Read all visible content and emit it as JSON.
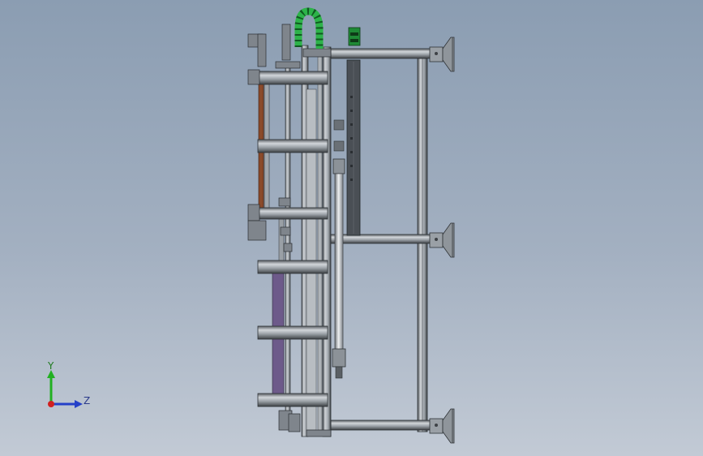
{
  "viewport": {
    "background_top": "#8b9db2",
    "background_bottom": "#c2cad5"
  },
  "model": {
    "frame_color": "#7f858c",
    "frame_dark": "#3e4246",
    "frame_light": "#c9ced3",
    "rail_color": "#b7bcc2",
    "cable_chain_color": "#2db34a",
    "bracket_color": "#8a4a2a"
  },
  "triad": {
    "y_label": "Y",
    "z_label": "Z",
    "y_color": "#22b022",
    "z_color": "#2440c8",
    "x_color": "#d02020"
  }
}
